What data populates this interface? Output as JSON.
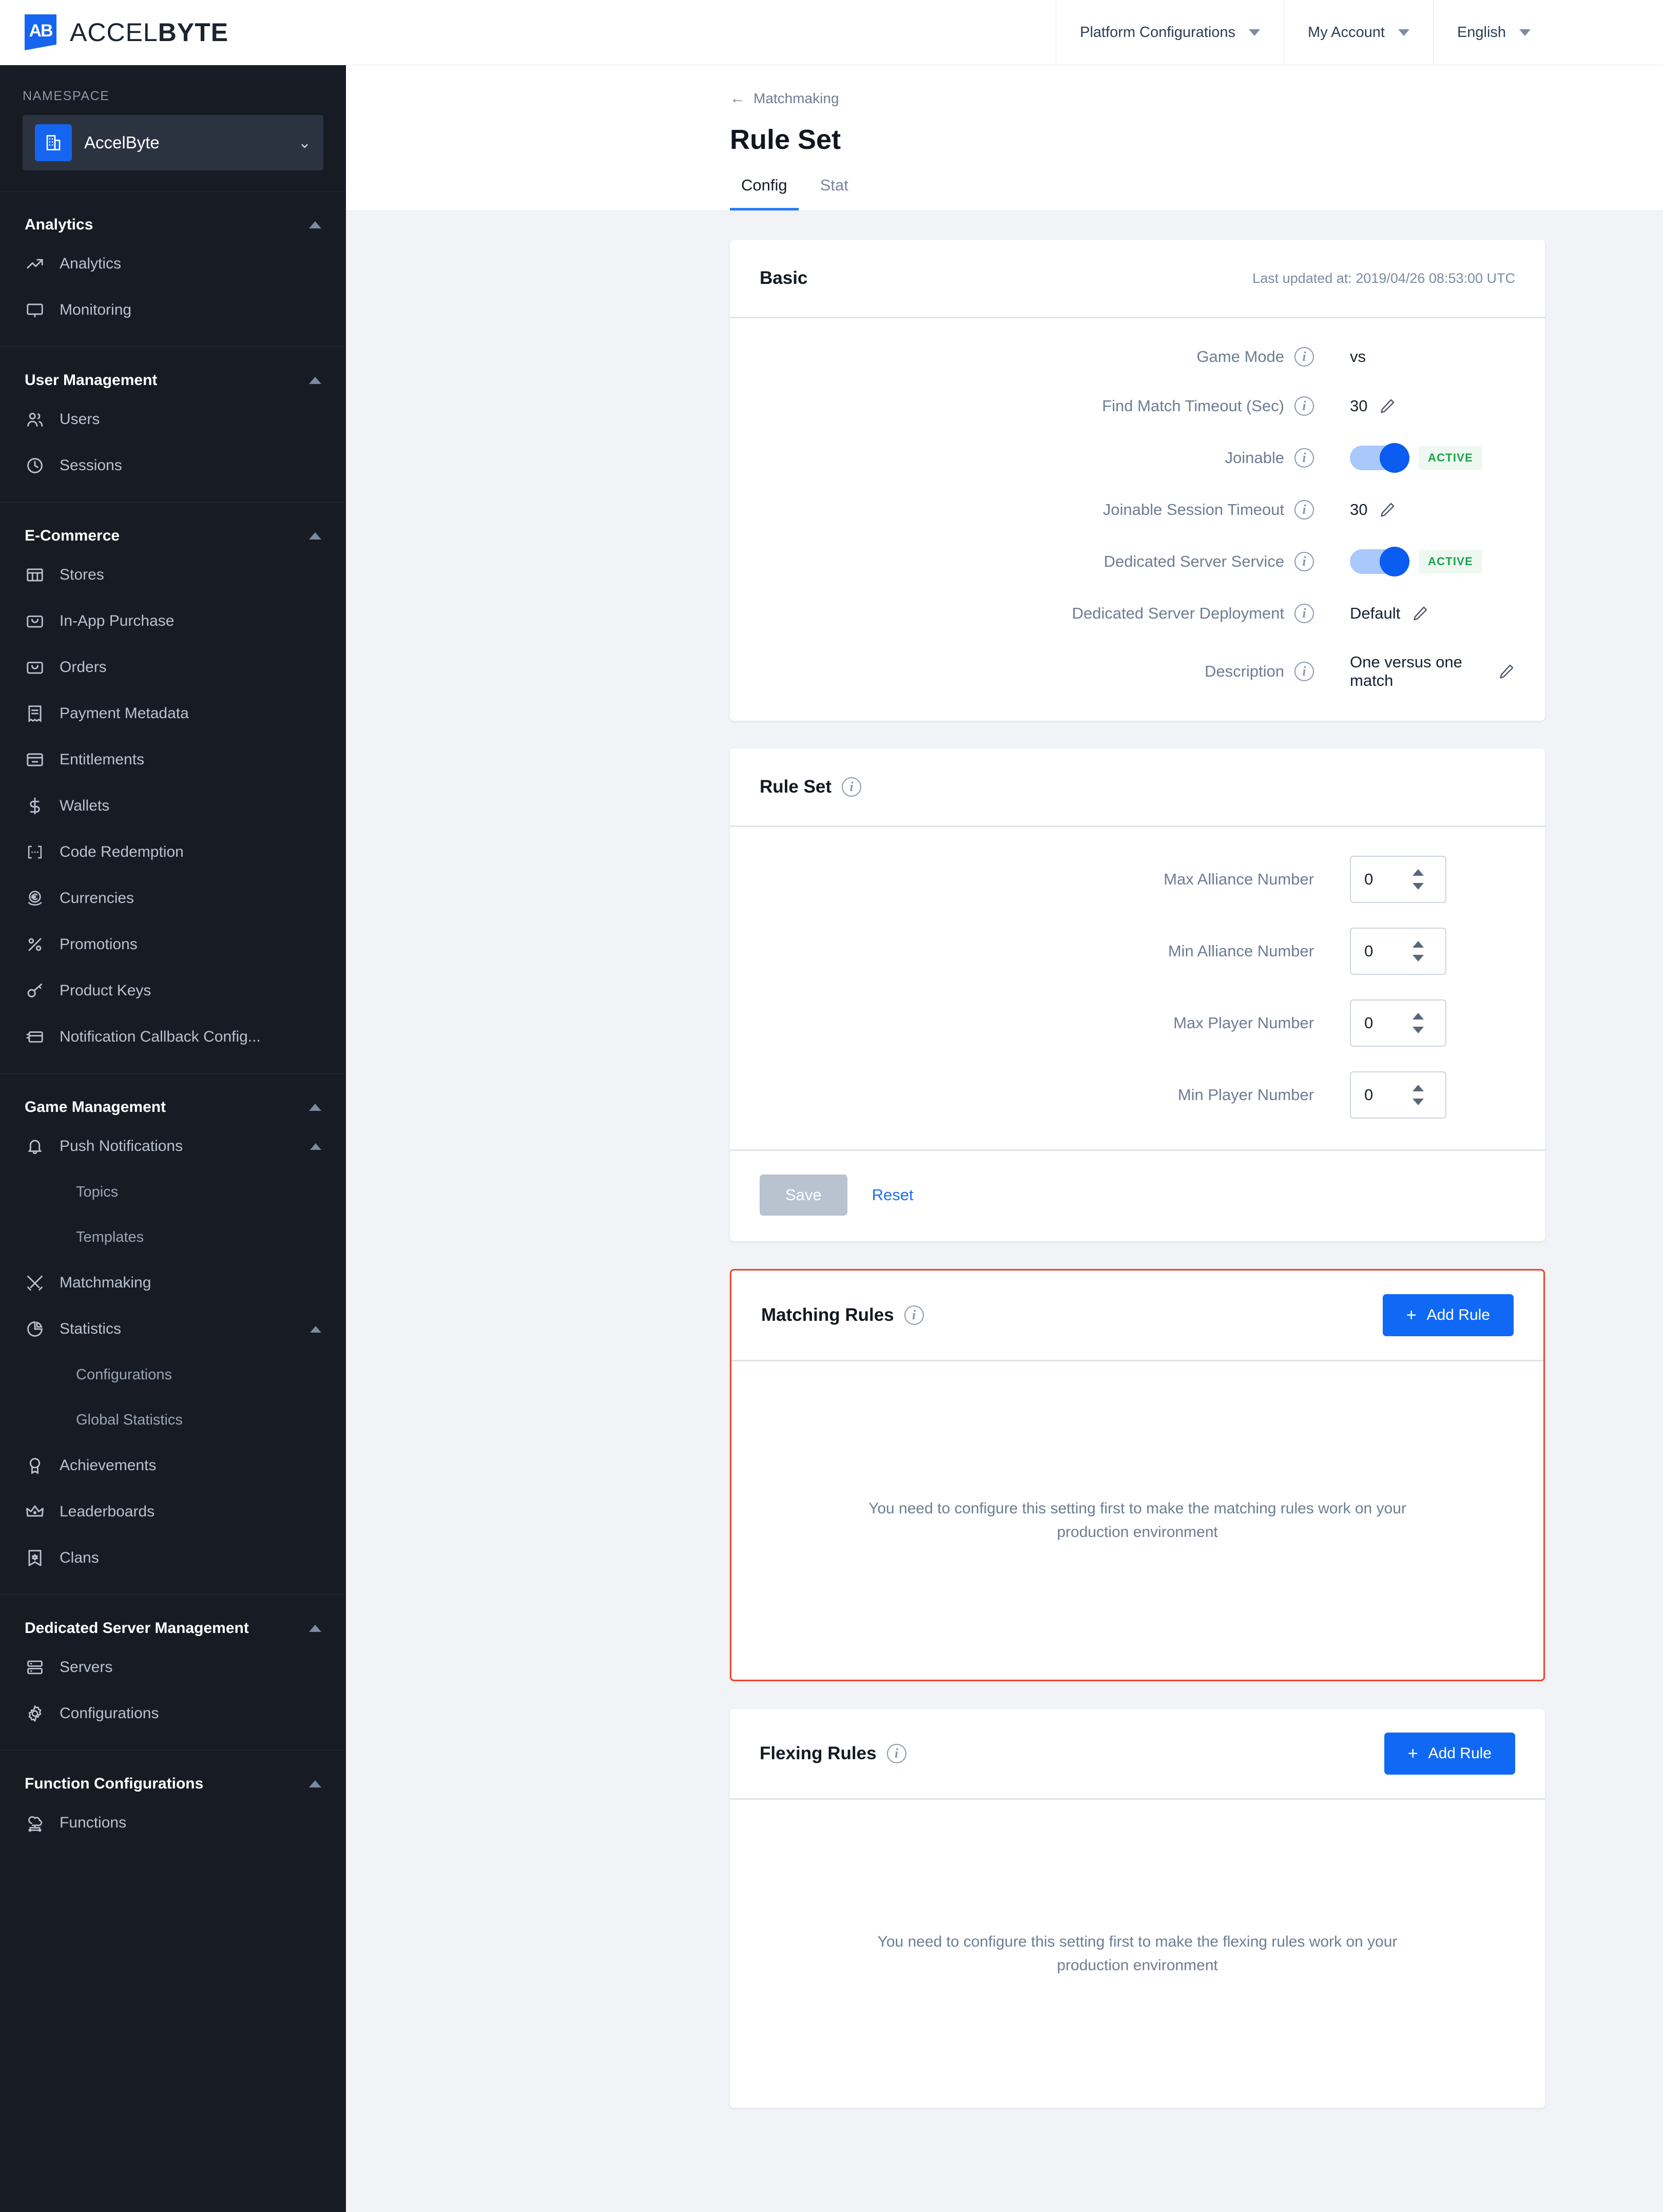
{
  "header": {
    "brand_prefix": "ACCEL",
    "brand_suffix": "BYTE",
    "brand_mark": "AB",
    "nav": [
      {
        "label": "Platform Configurations",
        "icon": "chevron-down-icon"
      },
      {
        "label": "My Account",
        "icon": "chevron-down-icon"
      },
      {
        "label": "English",
        "icon": "chevron-down-icon"
      }
    ]
  },
  "sidebar": {
    "namespace_label": "NAMESPACE",
    "namespace_value": "AccelByte",
    "namespace_icon": "building-icon",
    "groups": [
      {
        "title": "Analytics",
        "items": [
          {
            "label": "Analytics",
            "icon": "trend-up-icon"
          },
          {
            "label": "Monitoring",
            "icon": "monitor-icon"
          }
        ]
      },
      {
        "title": "User Management",
        "items": [
          {
            "label": "Users",
            "icon": "users-icon"
          },
          {
            "label": "Sessions",
            "icon": "clock-icon"
          }
        ]
      },
      {
        "title": "E-Commerce",
        "items": [
          {
            "label": "Stores",
            "icon": "store-icon"
          },
          {
            "label": "In-App Purchase",
            "icon": "bag-icon"
          },
          {
            "label": "Orders",
            "icon": "bag-icon"
          },
          {
            "label": "Payment Metadata",
            "icon": "receipt-icon"
          },
          {
            "label": "Entitlements",
            "icon": "card-minus-icon"
          },
          {
            "label": "Wallets",
            "icon": "dollar-icon"
          },
          {
            "label": "Code Redemption",
            "icon": "code-brackets-icon"
          },
          {
            "label": "Currencies",
            "icon": "euro-coin-icon"
          },
          {
            "label": "Promotions",
            "icon": "percent-icon"
          },
          {
            "label": "Product Keys",
            "icon": "key-icon"
          },
          {
            "label": "Notification Callback Config...",
            "icon": "callback-card-icon"
          }
        ]
      },
      {
        "title": "Game Management",
        "items": [
          {
            "label": "Push Notifications",
            "icon": "bell-icon",
            "expandable": true,
            "children": [
              {
                "label": "Topics"
              },
              {
                "label": "Templates"
              }
            ]
          },
          {
            "label": "Matchmaking",
            "icon": "swords-icon"
          },
          {
            "label": "Statistics",
            "icon": "pie-chart-icon",
            "expandable": true,
            "children": [
              {
                "label": "Configurations"
              },
              {
                "label": "Global Statistics"
              }
            ]
          },
          {
            "label": "Achievements",
            "icon": "medal-icon"
          },
          {
            "label": "Leaderboards",
            "icon": "crown-icon"
          },
          {
            "label": "Clans",
            "icon": "banner-icon"
          }
        ]
      },
      {
        "title": "Dedicated Server Management",
        "items": [
          {
            "label": "Servers",
            "icon": "server-icon"
          },
          {
            "label": "Configurations",
            "icon": "gear-icon"
          }
        ]
      },
      {
        "title": "Function Configurations",
        "items": [
          {
            "label": "Functions",
            "icon": "function-cloud-icon"
          }
        ]
      }
    ]
  },
  "page": {
    "breadcrumb": "Matchmaking",
    "breadcrumb_icon": "arrow-left-icon",
    "title": "Rule Set",
    "tabs": [
      {
        "label": "Config",
        "active": true
      },
      {
        "label": "Stat",
        "active": false
      }
    ]
  },
  "basic": {
    "title": "Basic",
    "last_updated": "Last updated at: 2019/04/26 08:53:00 UTC",
    "rows": [
      {
        "label": "Game Mode",
        "value": "vs",
        "type": "text",
        "editable": false
      },
      {
        "label": "Find Match Timeout (Sec)",
        "value": "30",
        "type": "text",
        "editable": true
      },
      {
        "label": "Joinable",
        "value": "ACTIVE",
        "type": "toggle",
        "on": true
      },
      {
        "label": "Joinable Session Timeout",
        "value": "30",
        "type": "text",
        "editable": true
      },
      {
        "label": "Dedicated Server Service",
        "value": "ACTIVE",
        "type": "toggle",
        "on": true
      },
      {
        "label": "Dedicated Server Deployment",
        "value": "Default",
        "type": "text",
        "editable": true
      },
      {
        "label": "Description",
        "value": "One versus one match",
        "type": "text",
        "editable": true
      }
    ]
  },
  "ruleset": {
    "title": "Rule Set",
    "fields": [
      {
        "label": "Max Alliance Number",
        "value": "0"
      },
      {
        "label": "Min Alliance Number",
        "value": "0"
      },
      {
        "label": "Max Player Number",
        "value": "0"
      },
      {
        "label": "Min Player Number",
        "value": "0"
      }
    ],
    "save_label": "Save",
    "reset_label": "Reset"
  },
  "matching_rules": {
    "title": "Matching Rules",
    "add_label": "Add Rule",
    "empty_message": "You need to configure this setting first to make the matching rules work on your production environment"
  },
  "flexing_rules": {
    "title": "Flexing Rules",
    "add_label": "Add Rule",
    "empty_message": "You need to configure this setting first to make the flexing rules work on your production environment"
  },
  "colors": {
    "accent": "#1069f4",
    "sidebar_bg": "#171c24",
    "active_badge": "#17a249",
    "error_outline": "#e8452f",
    "page_bg": "#f1f3f6"
  }
}
